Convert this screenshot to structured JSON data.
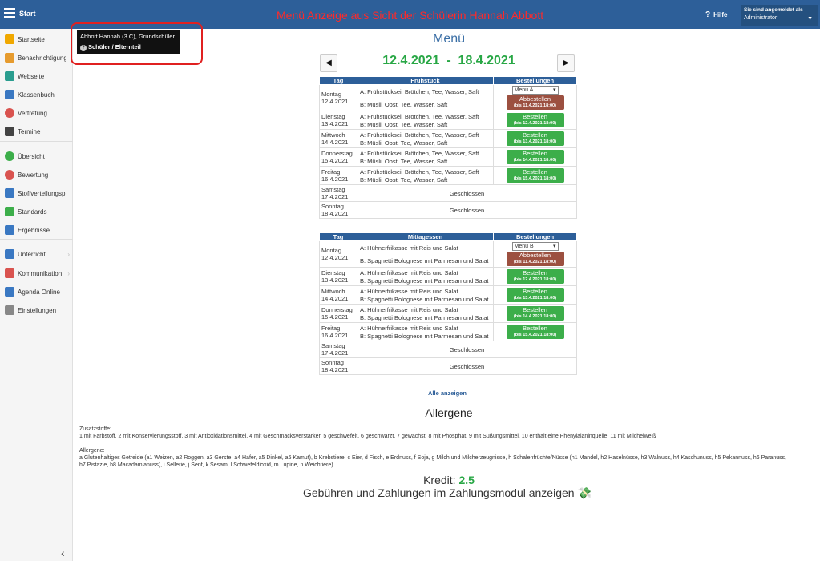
{
  "topbar": {
    "start_label": "Start",
    "annotation": "Menü Anzeige aus Sicht der Schülerin Hannah Abbott",
    "help_label": "Hilfe",
    "login_title": "Sie sind angemeldet als",
    "login_user": "Administrator"
  },
  "sidebar": {
    "items": [
      {
        "label": "Startseite",
        "icon": "star-icon",
        "color": "#f0a800"
      },
      {
        "label": "Benachrichtigungen",
        "icon": "envelope-icon",
        "color": "#e69b2e"
      },
      {
        "label": "Webseite",
        "icon": "home-icon",
        "color": "#2a9d8f"
      },
      {
        "label": "Klassenbuch",
        "icon": "book-icon",
        "color": "#3a78c2"
      },
      {
        "label": "Vertretung",
        "icon": "person-icon",
        "color": "#d9534f"
      },
      {
        "label": "Termine",
        "icon": "calendar-icon",
        "color": "#444"
      },
      {
        "label": "Übersicht",
        "icon": "check-icon",
        "color": "#3cae4a"
      },
      {
        "label": "Bewertung",
        "icon": "rating-icon",
        "color": "#d9534f"
      },
      {
        "label": "Stoffverteilungsplan",
        "icon": "briefcase-icon",
        "color": "#3a78c2"
      },
      {
        "label": "Standards",
        "icon": "shield-icon",
        "color": "#3cae4a"
      },
      {
        "label": "Ergebnisse",
        "icon": "bar-chart-icon",
        "color": "#3a78c2"
      },
      {
        "label": "Unterricht",
        "icon": "folder-icon",
        "color": "#3a78c2"
      },
      {
        "label": "Kommunikation",
        "icon": "chat-icon",
        "color": "#d9534f"
      },
      {
        "label": "Agenda Online",
        "icon": "pencil-icon",
        "color": "#3a78c2"
      },
      {
        "label": "Einstellungen",
        "icon": "gear-icon",
        "color": "#888"
      }
    ]
  },
  "userbox": {
    "name": "Abbott Hannah (3 C), Grundschüler",
    "role": "Schüler / Elternteil"
  },
  "main": {
    "title": "Menü",
    "week_from": "12.4.2021",
    "week_sep": "-",
    "week_to": "18.4.2021",
    "prev_label": "◀",
    "next_label": "▶",
    "col_day": "Tag",
    "col_breakfast": "Frühstück",
    "col_lunch": "Mittagessen",
    "col_orders": "Bestellungen",
    "closed": "Geschlossen",
    "show_all": "Alle anzeigen",
    "allergens_title": "Allergene",
    "additives_title": "Zusatzstoffe:",
    "additives_text": "1 mit Farbstoff, 2 mit Konservierungsstoff, 3 mit Antioxidationsmittel, 4 mit Geschmacksverstärker, 5 geschwefelt, 6 geschwärzt, 7 gewachst, 8 mit Phosphat, 9 mit Süßungsmittel, 10 enthält eine Phenylalaninquelle, 11 mit Milcheiweiß",
    "allergens_label": "Allergene:",
    "allergens_text": "a Glutenhaltiges Getreide (a1 Weizen, a2 Roggen, a3 Gerste, a4 Hafer, a5 Dinkel, a6 Kamut), b Krebstiere, c Eier, d Fisch, e Erdnuss, f Soja, g Milch und Milcherzeugnisse, h Schalenfrüchte/Nüsse (h1 Mandel, h2 Haselnüsse, h3 Walnuss, h4 Kaschunuss, h5 Pekannuss, h6 Paranuss, h7 Pistazie, h8 Macadamianuss), i Sellerie, j Senf, k Sesam, l Schwefeldioxid, m Lupine, n Weichtiere)",
    "credit_label": "Kredit:",
    "credit_value": "2.5",
    "fees_text": "Gebühren und Zahlungen im Zahlungsmodul anzeigen",
    "breakfast": {
      "a": "A: Frühstücksei, Brötchen, Tee, Wasser, Saft",
      "b": "B: Müsli, Obst, Tee, Wasser, Saft",
      "select_value": "Menu A"
    },
    "lunch": {
      "a": "A: Hühnerfrikasse mit Reis und Salat",
      "b": "B: Spaghetti Bolognese mit Parmesan und Salat",
      "select_value": "Menu B"
    },
    "days": [
      {
        "name": "Montag",
        "date": "12.4.2021",
        "btn": "Abbestellen",
        "deadline": "(bis 11.4.2021 18:00)",
        "status": "ordered"
      },
      {
        "name": "Dienstag",
        "date": "13.4.2021",
        "btn": "Bestellen",
        "deadline": "(bis 12.4.2021 18:00)",
        "status": "open"
      },
      {
        "name": "Mittwoch",
        "date": "14.4.2021",
        "btn": "Bestellen",
        "deadline": "(bis 13.4.2021 18:00)",
        "status": "open"
      },
      {
        "name": "Donnerstag",
        "date": "15.4.2021",
        "btn": "Bestellen",
        "deadline": "(bis 14.4.2021 18:00)",
        "status": "open"
      },
      {
        "name": "Freitag",
        "date": "16.4.2021",
        "btn": "Bestellen",
        "deadline": "(bis 15.4.2021 18:00)",
        "status": "open"
      },
      {
        "name": "Samstag",
        "date": "17.4.2021",
        "status": "closed"
      },
      {
        "name": "Sonntag",
        "date": "18.4.2021",
        "status": "closed"
      }
    ]
  }
}
